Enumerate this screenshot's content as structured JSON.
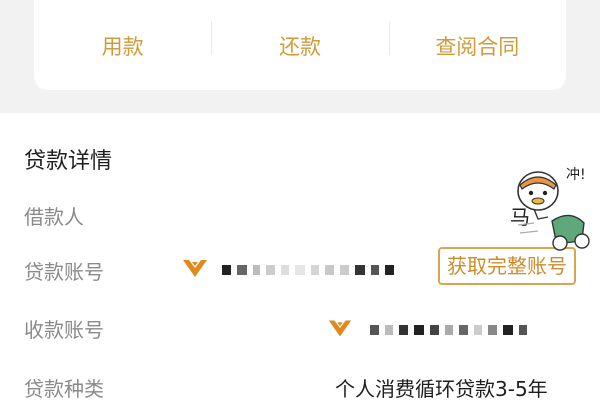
{
  "actions": {
    "use_label": "用款",
    "repay_label": "还款",
    "contract_label": "查阅合同"
  },
  "details": {
    "title": "贷款详情",
    "borrower": {
      "label": "借款人",
      "value": "马"
    },
    "loan_account": {
      "label": "贷款账号",
      "button_label": "获取完整账号"
    },
    "receiving_account": {
      "label": "收款账号"
    },
    "loan_type": {
      "label": "贷款种类",
      "value": "个人消费循环贷款3-5年"
    }
  },
  "sticker_text": "冲!",
  "colors": {
    "accent": "#cf9b3d",
    "bank_logo": "#e08a1e",
    "label_gray": "#8a8a8a"
  },
  "icons": {
    "bank_logo": "diamond-bank-logo-icon",
    "sticker": "duck-on-scooter-sticker-icon"
  }
}
